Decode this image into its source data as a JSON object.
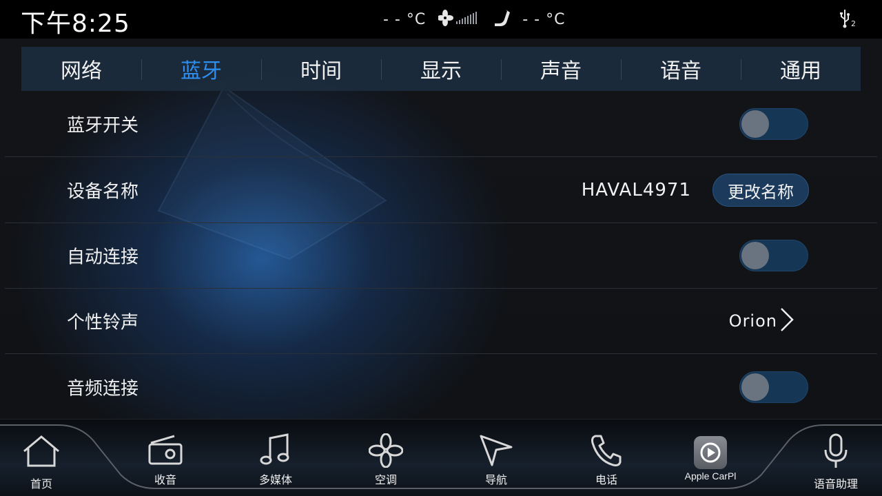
{
  "status_bar": {
    "time": "下午8:25",
    "temp_left": "- - °C",
    "temp_right": "- - °C",
    "fan_icon": "fan-icon",
    "seat_icon": "seat-icon",
    "usb_icon": "usb-icon",
    "usb_badge": "2"
  },
  "tabs": [
    {
      "label": "网络",
      "active": false
    },
    {
      "label": "蓝牙",
      "active": true
    },
    {
      "label": "时间",
      "active": false
    },
    {
      "label": "显示",
      "active": false
    },
    {
      "label": "声音",
      "active": false
    },
    {
      "label": "语音",
      "active": false
    },
    {
      "label": "通用",
      "active": false
    }
  ],
  "bluetooth": {
    "switch_label": "蓝牙开关",
    "device_name_label": "设备名称",
    "device_name_value": "HAVAL4971",
    "rename_button": "更改名称",
    "auto_connect_label": "自动连接",
    "ringtone_label": "个性铃声",
    "ringtone_value": "Orion",
    "audio_connect_label": "音频连接"
  },
  "dock": {
    "home": "首页",
    "radio": "收音",
    "media": "多媒体",
    "climate": "空调",
    "navigation": "导航",
    "phone": "电话",
    "carplay": "Apple CarPl",
    "voice_assistant": "语音助理"
  },
  "colors": {
    "accent": "#2d8ff0",
    "toggle_track": "#163656",
    "toggle_knob": "#6a7480",
    "tab_bar": "#1c2c3e"
  }
}
